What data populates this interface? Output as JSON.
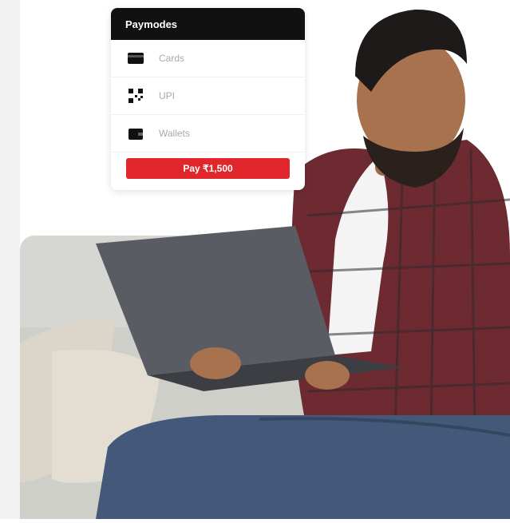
{
  "paycard": {
    "title": "Paymodes",
    "methods": [
      {
        "label": "Cards",
        "icon": "card-icon"
      },
      {
        "label": "UPI",
        "icon": "qr-icon"
      },
      {
        "label": "Wallets",
        "icon": "wallet-icon"
      }
    ],
    "pay_label": "Pay ₹1,500",
    "accent_color": "#e0262b"
  },
  "photo": {
    "icon": "man-with-laptop-on-sofa"
  }
}
